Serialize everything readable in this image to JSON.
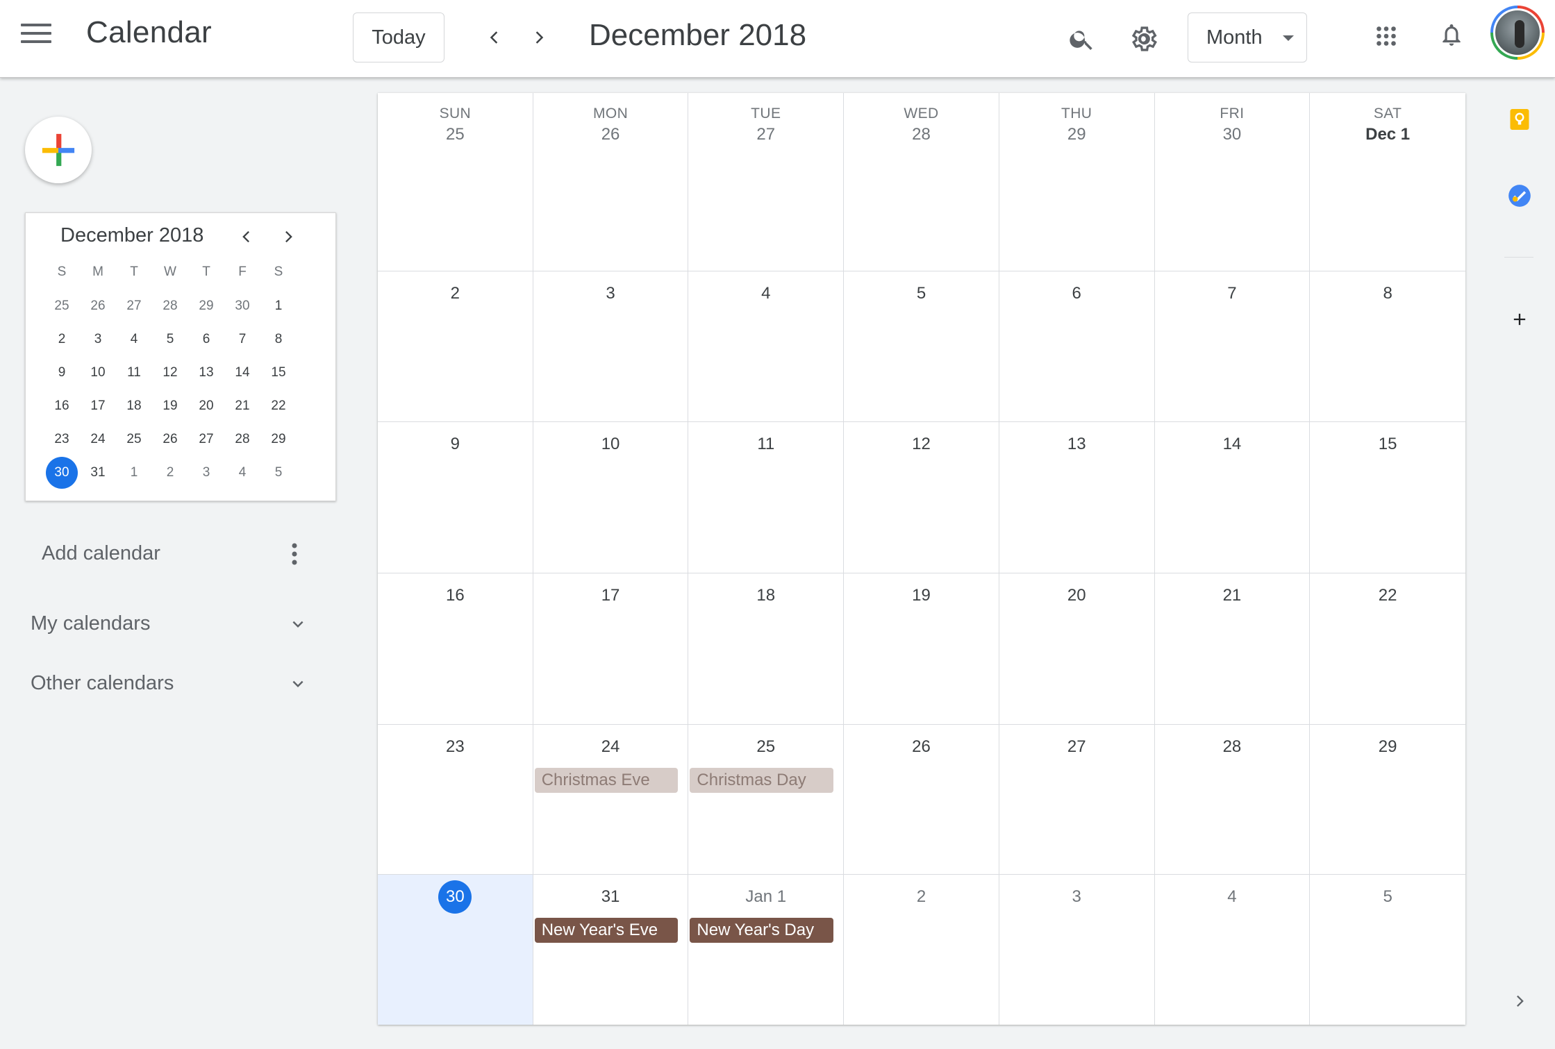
{
  "header": {
    "app_title": "Calendar",
    "today_label": "Today",
    "current_period": "December 2018",
    "view_label": "Month"
  },
  "colors": {
    "primary": "#1a73e8",
    "event_past_bg": "#d7ccc8",
    "event_future_bg": "#795548",
    "today_bg": "#e8f0fe"
  },
  "mini_calendar": {
    "title": "December 2018",
    "weekdays": [
      "S",
      "M",
      "T",
      "W",
      "T",
      "F",
      "S"
    ],
    "weeks": [
      [
        "25",
        "26",
        "27",
        "28",
        "29",
        "30",
        "1"
      ],
      [
        "2",
        "3",
        "4",
        "5",
        "6",
        "7",
        "8"
      ],
      [
        "9",
        "10",
        "11",
        "12",
        "13",
        "14",
        "15"
      ],
      [
        "16",
        "17",
        "18",
        "19",
        "20",
        "21",
        "22"
      ],
      [
        "23",
        "24",
        "25",
        "26",
        "27",
        "28",
        "29"
      ],
      [
        "30",
        "31",
        "1",
        "2",
        "3",
        "4",
        "5"
      ]
    ],
    "selected": "30"
  },
  "sidebar": {
    "add_calendar_placeholder": "Add calendar",
    "my_calendars": "My calendars",
    "other_calendars": "Other calendars"
  },
  "month": {
    "weekday_headers": [
      "SUN",
      "MON",
      "TUE",
      "WED",
      "THU",
      "FRI",
      "SAT"
    ],
    "first_row": [
      "25",
      "26",
      "27",
      "28",
      "29",
      "30",
      "Dec 1"
    ],
    "rows": [
      [
        "2",
        "3",
        "4",
        "5",
        "6",
        "7",
        "8"
      ],
      [
        "9",
        "10",
        "11",
        "12",
        "13",
        "14",
        "15"
      ],
      [
        "16",
        "17",
        "18",
        "19",
        "20",
        "21",
        "22"
      ],
      [
        "23",
        "24",
        "25",
        "26",
        "27",
        "28",
        "29"
      ],
      [
        "30",
        "31",
        "Jan 1",
        "2",
        "3",
        "4",
        "5"
      ]
    ],
    "events": {
      "christmas_eve": "Christmas Eve",
      "christmas_day": "Christmas Day",
      "new_years_eve": "New Year's Eve",
      "new_years_day": "New Year's Day"
    }
  },
  "icons": {
    "menu": "hamburger-icon",
    "prev": "chevron-left-icon",
    "next": "chevron-right-icon",
    "search": "search-icon",
    "settings": "gear-icon",
    "apps": "apps-grid-icon",
    "notifications": "bell-icon",
    "keep": "keep-icon",
    "tasks": "tasks-icon",
    "add": "plus-icon"
  }
}
